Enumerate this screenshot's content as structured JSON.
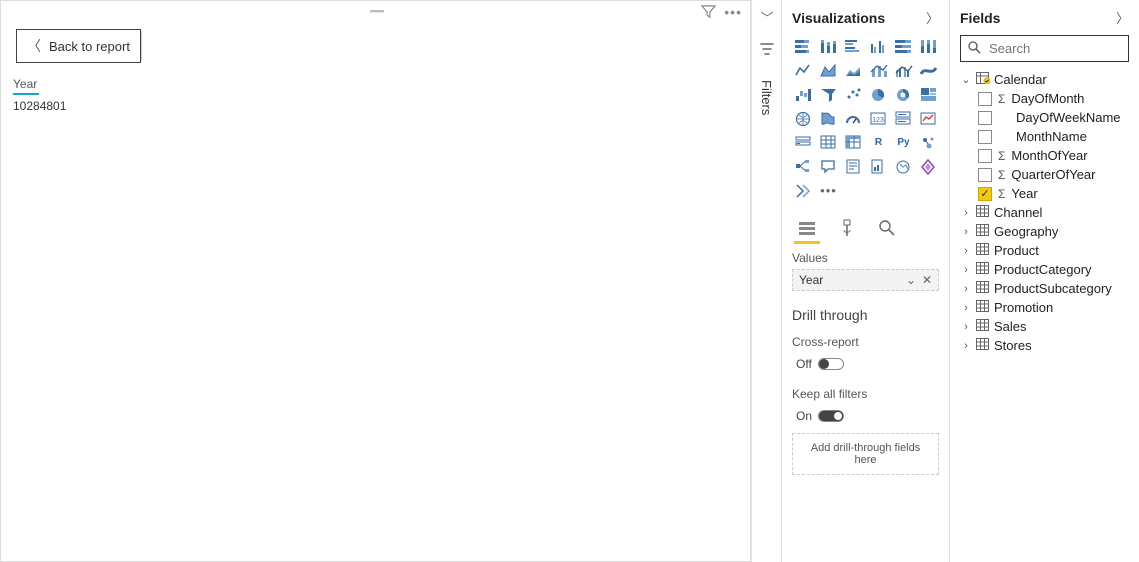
{
  "canvas": {
    "back_label": "Back to report",
    "card_label": "Year",
    "card_value": "10284801"
  },
  "rail": {
    "filters_label": "Filters"
  },
  "viz": {
    "title": "Visualizations",
    "tabs": {
      "fields": "Fields",
      "format": "Format",
      "analytics": "Analytics"
    },
    "values_label": "Values",
    "values": {
      "field": "Year"
    },
    "drill": {
      "title": "Drill through",
      "cross_label": "Cross-report",
      "cross_state": "Off",
      "keep_label": "Keep all filters",
      "keep_state": "On",
      "drop_text": "Add drill-through fields here"
    }
  },
  "fields": {
    "title": "Fields",
    "search_placeholder": "Search",
    "tables": [
      {
        "name": "Calendar",
        "expanded": true,
        "marked": true,
        "columns": [
          {
            "name": "DayOfMonth",
            "numeric": true,
            "checked": false
          },
          {
            "name": "DayOfWeekName",
            "numeric": false,
            "checked": false
          },
          {
            "name": "MonthName",
            "numeric": false,
            "checked": false
          },
          {
            "name": "MonthOfYear",
            "numeric": true,
            "checked": false
          },
          {
            "name": "QuarterOfYear",
            "numeric": true,
            "checked": false
          },
          {
            "name": "Year",
            "numeric": true,
            "checked": true
          }
        ]
      },
      {
        "name": "Channel",
        "expanded": false
      },
      {
        "name": "Geography",
        "expanded": false
      },
      {
        "name": "Product",
        "expanded": false
      },
      {
        "name": "ProductCategory",
        "expanded": false
      },
      {
        "name": "ProductSubcategory",
        "expanded": false
      },
      {
        "name": "Promotion",
        "expanded": false
      },
      {
        "name": "Sales",
        "expanded": false
      },
      {
        "name": "Stores",
        "expanded": false
      }
    ]
  }
}
